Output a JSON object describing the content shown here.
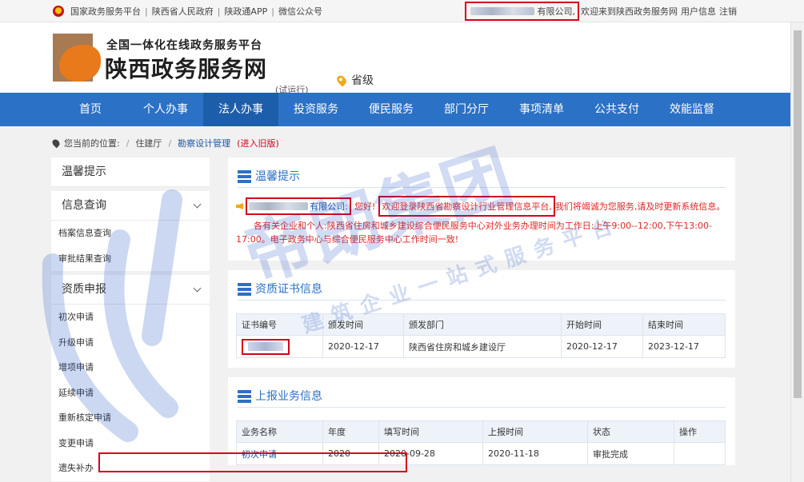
{
  "topbar": {
    "links": [
      "国家政务服务平台",
      "陕西省人民政府",
      "陕政通APP",
      "微信公众号"
    ],
    "company_suffix": "有限公司,",
    "welcome": "欢迎来到陕西政务服务网",
    "user_info": "用户信息",
    "logout": "注销"
  },
  "header": {
    "subtitle": "全国一体化在线政务服务平台",
    "title": "陕西政务服务网",
    "trial": "(试运行)",
    "region": "省级"
  },
  "nav": {
    "items": [
      "首页",
      "个人办事",
      "法人办事",
      "投资服务",
      "便民服务",
      "部门分厅",
      "事项清单",
      "公共支付",
      "效能监督"
    ],
    "active_index": 2
  },
  "breadcrumb": {
    "prefix": "您当前的位置:",
    "level1": "住建厅",
    "level2": "勘察设计管理",
    "old": "(进入旧版)"
  },
  "sidebar": {
    "notice_title": "温馨提示",
    "query_title": "信息查询",
    "query_items": [
      "档案信息查询",
      "审批结果查询"
    ],
    "apply_title": "资质申报",
    "apply_items": [
      "初次申请",
      "升级申请",
      "增项申请",
      "延续申请",
      "重新核定申请",
      "变更申请",
      "遗失补办"
    ]
  },
  "notice": {
    "title": "温馨提示",
    "company_suffix": "有限公司:",
    "greeting": "您好!",
    "welcome": "欢迎登录陕西省勘察设计行业管理信息平台,",
    "tail": "我们将竭诚为您服务,请及时更新系统信息。",
    "line2": "各有关企业和个人:陕西省住房和城乡建设综合便民服务中心对外业务办理时间为工作日:上午9:00--12:00,下午13:00-",
    "line3": "17:00。电子政务中心与综合便民服务中心工作时间一致!"
  },
  "cert": {
    "title": "资质证书信息",
    "columns": [
      "证书编号",
      "颁发时间",
      "颁发部门",
      "开始时间",
      "结束时间"
    ],
    "rows": [
      {
        "issue_date": "2020-12-17",
        "dept": "陕西省住房和城乡建设厅",
        "start": "2020-12-17",
        "end": "2023-12-17"
      }
    ]
  },
  "biz": {
    "title": "上报业务信息",
    "columns": [
      "业务名称",
      "年度",
      "填写时间",
      "上报时间",
      "状态",
      "操作"
    ],
    "rows": [
      {
        "name": "初次申请",
        "year": "2020",
        "fill_date": "2020-09-28",
        "report_date": "2020-11-18",
        "status": "审批完成",
        "action": ""
      }
    ]
  },
  "watermark": {
    "brand": "帝朗集团",
    "slogan": "建筑企业一站式服务平台",
    "color": "#1e50c8"
  }
}
